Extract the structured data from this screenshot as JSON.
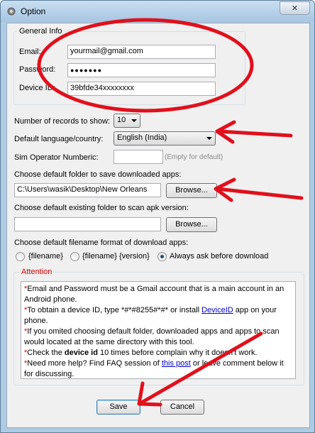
{
  "window": {
    "title": "Option",
    "close_glyph": "✕"
  },
  "general": {
    "legend": "General Info",
    "email_label": "Email:",
    "email_value": "yourmail@gmail.com",
    "password_label": "Password:",
    "password_value": "●●●●●●●",
    "device_label": "Device ID:",
    "device_value": "39bfde34xxxxxxxx"
  },
  "records": {
    "label": "Number of records  to show:",
    "value": "10"
  },
  "language": {
    "label": "Default language/country:",
    "value": "English (India)"
  },
  "sim": {
    "label": "Sim Operator Numberic:",
    "value": "",
    "hint": "(Empty for default)"
  },
  "download_folder": {
    "label": "Choose default folder to save downloaded apps:",
    "value": "C:\\Users\\wasik\\Desktop\\New Orleans",
    "browse": "Browse..."
  },
  "scan_folder": {
    "label": "Choose default existing folder to scan apk version:",
    "value": "",
    "browse": "Browse..."
  },
  "filename_format": {
    "label": "Choose default filename format of download apps:",
    "options": [
      "{filename}",
      "{filename} {version}",
      "Always ask before download"
    ],
    "selected": "Always ask before download"
  },
  "attention": {
    "legend": "Attention",
    "line1": "Email and Password must be a Gmail account that is a main account in an Android phone.",
    "line2a": "To obtain a device ID, type *#*#8255#*#* or install ",
    "line2_link": "DeviceID",
    "line2b": " app on your phone.",
    "line3": "If you omited choosing default folder, downloaded apps and apps to scan would located at the same directory with this tool.",
    "line4a": "Check the ",
    "line4_bold": "device id",
    "line4b": " 10 times before complain why it doesn't work.",
    "line5a": "Need more help? Find FAQ session of ",
    "line5_link": "this post",
    "line5b": " or leave comment below it for discussing."
  },
  "buttons": {
    "save": "Save",
    "cancel": "Cancel"
  },
  "colors": {
    "annotation": "#e0101c",
    "window_frame": "#aecbe4",
    "dialog_bg": "#f0f0f0"
  }
}
